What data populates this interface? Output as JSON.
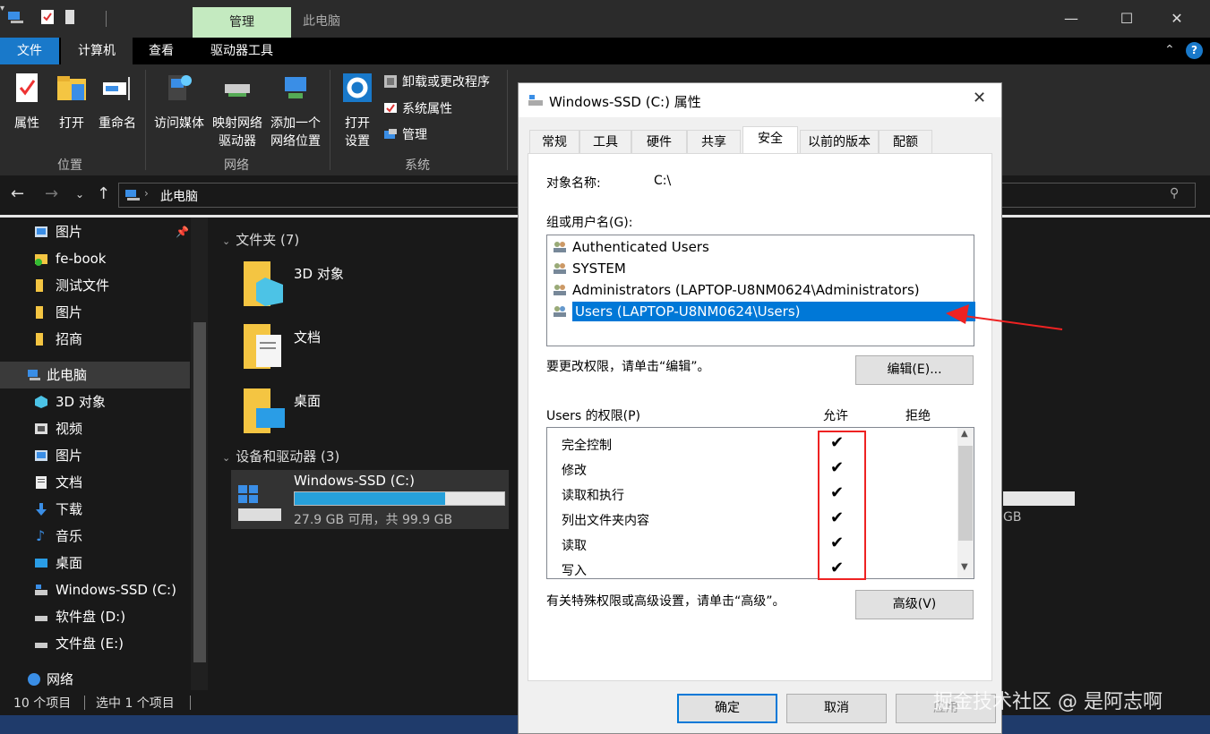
{
  "titlebar": {
    "manage_tab": "管理",
    "title": "此电脑",
    "minimize": "—",
    "maximize": "☐",
    "close": "✕"
  },
  "ribbon_tabs": [
    "文件",
    "计算机",
    "查看",
    "驱动器工具"
  ],
  "ribbon": {
    "location": {
      "label": "位置",
      "buttons": [
        "属性",
        "打开",
        "重命名"
      ]
    },
    "network": {
      "label": "网络",
      "buttons": [
        "访问媒体",
        "映射网络",
        "驱动器",
        "添加一个",
        "网络位置"
      ]
    },
    "system": {
      "label": "系统",
      "open_settings": [
        "打开",
        "设置"
      ],
      "small": [
        "卸载或更改程序",
        "系统属性",
        "管理"
      ]
    }
  },
  "address": {
    "path": "此电脑"
  },
  "nav_pane": {
    "items": [
      {
        "label": "图片",
        "icon": "pictures-icon"
      },
      {
        "label": "fe-book",
        "icon": "folder-icon"
      },
      {
        "label": "测试文件",
        "icon": "folder-icon"
      },
      {
        "label": "图片",
        "icon": "folder-icon"
      },
      {
        "label": "招商",
        "icon": "folder-icon"
      },
      {
        "label": "此电脑",
        "icon": "pc-icon"
      },
      {
        "label": "3D 对象",
        "icon": "3d-objects-icon"
      },
      {
        "label": "视频",
        "icon": "video-icon"
      },
      {
        "label": "图片",
        "icon": "pictures-icon"
      },
      {
        "label": "文档",
        "icon": "documents-icon"
      },
      {
        "label": "下载",
        "icon": "download-icon"
      },
      {
        "label": "音乐",
        "icon": "music-icon"
      },
      {
        "label": "桌面",
        "icon": "desktop-icon"
      },
      {
        "label": "Windows-SSD (C:)",
        "icon": "drive-icon"
      },
      {
        "label": "软件盘 (D:)",
        "icon": "drive-icon"
      },
      {
        "label": "文件盘 (E:)",
        "icon": "drive-icon"
      },
      {
        "label": "网络",
        "icon": "network-icon"
      }
    ]
  },
  "content": {
    "folders_header": "文件夹 (7)",
    "folders": [
      "3D 对象",
      "文档",
      "桌面"
    ],
    "devices_header": "设备和驱动器 (3)",
    "drive": {
      "name": "Windows-SSD (C:)",
      "free": "27.9 GB 可用，共 99.9 GB",
      "used_fraction": 0.72
    },
    "drive2_gb": "GB"
  },
  "status": {
    "count": "10 个项目",
    "selected": "选中 1 个项目"
  },
  "dialog": {
    "title": "Windows-SSD (C:) 属性",
    "tabs": [
      "常规",
      "工具",
      "硬件",
      "共享",
      "安全",
      "以前的版本",
      "配额"
    ],
    "object_label": "对象名称:",
    "object_value": "C:\\",
    "group_label": "组或用户名(G):",
    "users": [
      "Authenticated Users",
      "SYSTEM",
      "Administrators (LAPTOP-U8NM0624\\Administrators)",
      "Users (LAPTOP-U8NM0624\\Users)"
    ],
    "change_hint": "要更改权限，请单击“编辑”。",
    "edit_button": "编辑(E)...",
    "perm_label": "Users 的权限(P)",
    "allow": "允许",
    "deny": "拒绝",
    "permissions": [
      "完全控制",
      "修改",
      "读取和执行",
      "列出文件夹内容",
      "读取",
      "写入"
    ],
    "checkmark": "✔",
    "advanced_hint": "有关特殊权限或高级设置，请单击“高级”。",
    "advanced_button": "高级(V)",
    "ok": "确定",
    "cancel": "取消",
    "apply": "应用"
  },
  "watermark": "掘金技术社区 @ 是阿志啊",
  "colors": {
    "accent": "#1979ca",
    "selection": "#0078d7",
    "highlight_box": "#e22222",
    "manage_tab": "#c4eac0"
  }
}
